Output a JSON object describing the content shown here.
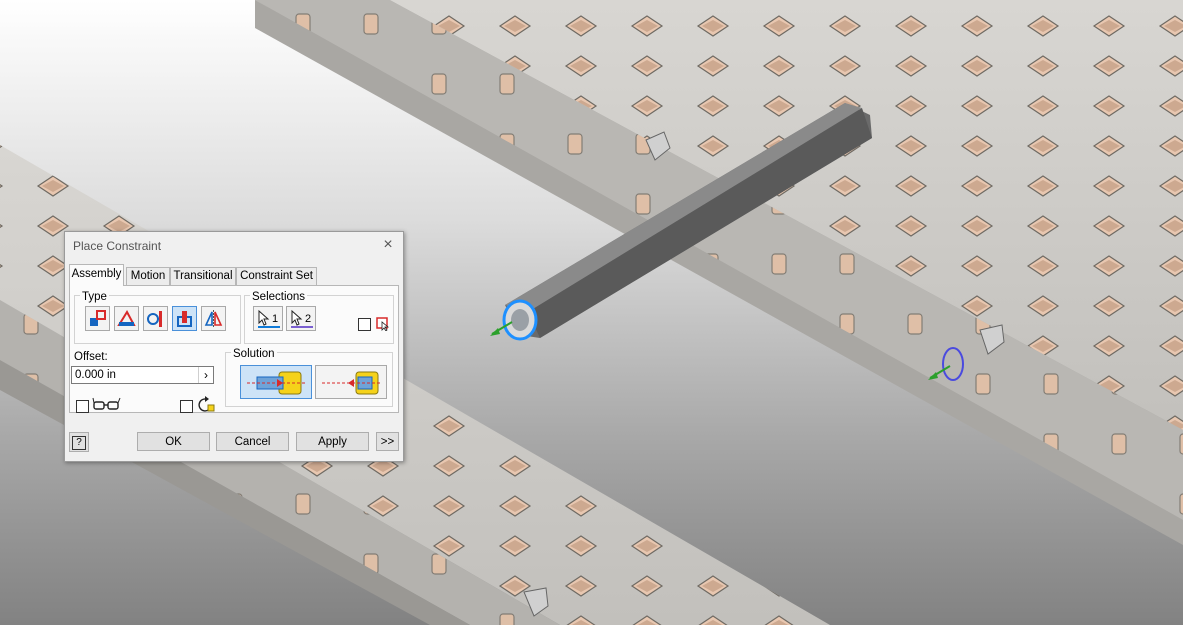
{
  "dialog": {
    "title": "Place Constraint",
    "close_glyph": "×",
    "tabs": [
      "Assembly",
      "Motion",
      "Transitional",
      "Constraint Set"
    ],
    "type_label": "Type",
    "selections_label": "Selections",
    "selection1_label": "1",
    "selection2_label": "2",
    "offset_label": "Offset:",
    "offset_value": "0.000 in",
    "offset_arrow": "›",
    "solution_label": "Solution",
    "help_glyph": "?",
    "ok_label": "OK",
    "cancel_label": "Cancel",
    "apply_label": "Apply",
    "more_label": ">>"
  },
  "icons": {
    "type_buttons": [
      "mate-icon",
      "angle-icon",
      "tangent-icon",
      "insert-icon",
      "symmetry-icon"
    ],
    "selected_type": "insert-icon",
    "solution_buttons": [
      "opposed-icon",
      "aligned-icon"
    ],
    "selected_solution": "opposed-icon"
  },
  "colors": {
    "selection_blue": "#0f7ad8",
    "insert_yellow": "#f5d21a",
    "constraint_red": "#d82a2a",
    "highlight_circle": "#1e90ff"
  }
}
